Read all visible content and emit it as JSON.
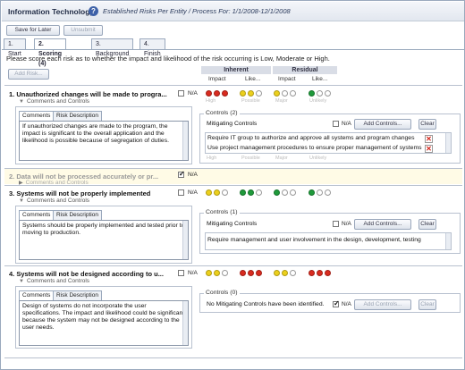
{
  "app": {
    "title": "Information Technology",
    "subtitle": "Established Risks Per Entity / Process For: 1/1/2008-12/1/2008"
  },
  "toolbar": {
    "save_label": "Save for Later",
    "unsubmit_label": "Unsubmit"
  },
  "tabs": [
    {
      "label": "1. Start"
    },
    {
      "label": "2. Scoring (4)"
    },
    {
      "label": "3. Background"
    },
    {
      "label": "4. Finish"
    }
  ],
  "instructions": "Please score each risk as to whether the impact and likelihood of the risk occurring is Low, Moderate or High.",
  "add_risk_label": "Add Risk...",
  "headers": {
    "inherent": "Inherent",
    "residual": "Residual",
    "impact": "Impact",
    "likelihood": "Like..."
  },
  "rating_labels": [
    "High",
    "Possible",
    "Major",
    "Unlikely"
  ],
  "common": {
    "comments_and_controls": "Comments and Controls",
    "comments_tab": "Comments",
    "risk_description_tab": "Risk Description",
    "na_label": "N/A",
    "mitigating_controls": "Mitigating Controls",
    "add_controls": "Add Controls...",
    "clear": "Clear"
  },
  "risks": [
    {
      "title": "1. Unauthorized changes will be made to progra...",
      "comment": "If unauthorized changes are made to the program, the impact is significant to the overall application and the likelihood is possible because of segregation of duties.",
      "controls_label": "Controls (2)",
      "controls": [
        "Require IT group to authorize and approve all systems and program changes",
        "Use project management procedures to ensure proper management of systems"
      ],
      "ratings": [
        [
          "red",
          "red",
          "red"
        ],
        [
          "yellow",
          "yellow",
          "empty"
        ],
        [
          "yellow",
          "empty",
          "empty"
        ],
        [
          "green",
          "empty",
          "empty"
        ]
      ]
    },
    {
      "title": "2. Data will not be processed accurately or pr..."
    },
    {
      "title": "3. Systems will not be properly implemented",
      "comment": "Systems should be properly implemented and tested prior to moving to production.",
      "controls_label": "Controls (1)",
      "controls": [
        "Require management and user involvement in the design, development, testing"
      ],
      "ratings": [
        [
          "yellow",
          "yellow",
          "empty"
        ],
        [
          "green",
          "green",
          "empty"
        ],
        [
          "green",
          "empty",
          "empty"
        ],
        [
          "green",
          "empty",
          "empty"
        ]
      ]
    },
    {
      "title": "4. Systems will not be designed according to u...",
      "comment": "Design of systems do not incorporate the user specifications. The impact and likelihood could be significant because the system may not be designed according to the user needs.",
      "controls_label": "Controls (0)",
      "no_controls_text": "No Mitigating Controls have been identified.",
      "ratings": [
        [
          "yellow",
          "yellow",
          "empty"
        ],
        [
          "red",
          "red",
          "red"
        ],
        [
          "yellow",
          "yellow",
          "empty"
        ],
        [
          "red",
          "red",
          "red"
        ]
      ]
    }
  ],
  "colors": {
    "red": "#d92b1f",
    "yellow": "#ecd01c",
    "green": "#1e9a3a",
    "title_bar": "#e2e7ef"
  }
}
